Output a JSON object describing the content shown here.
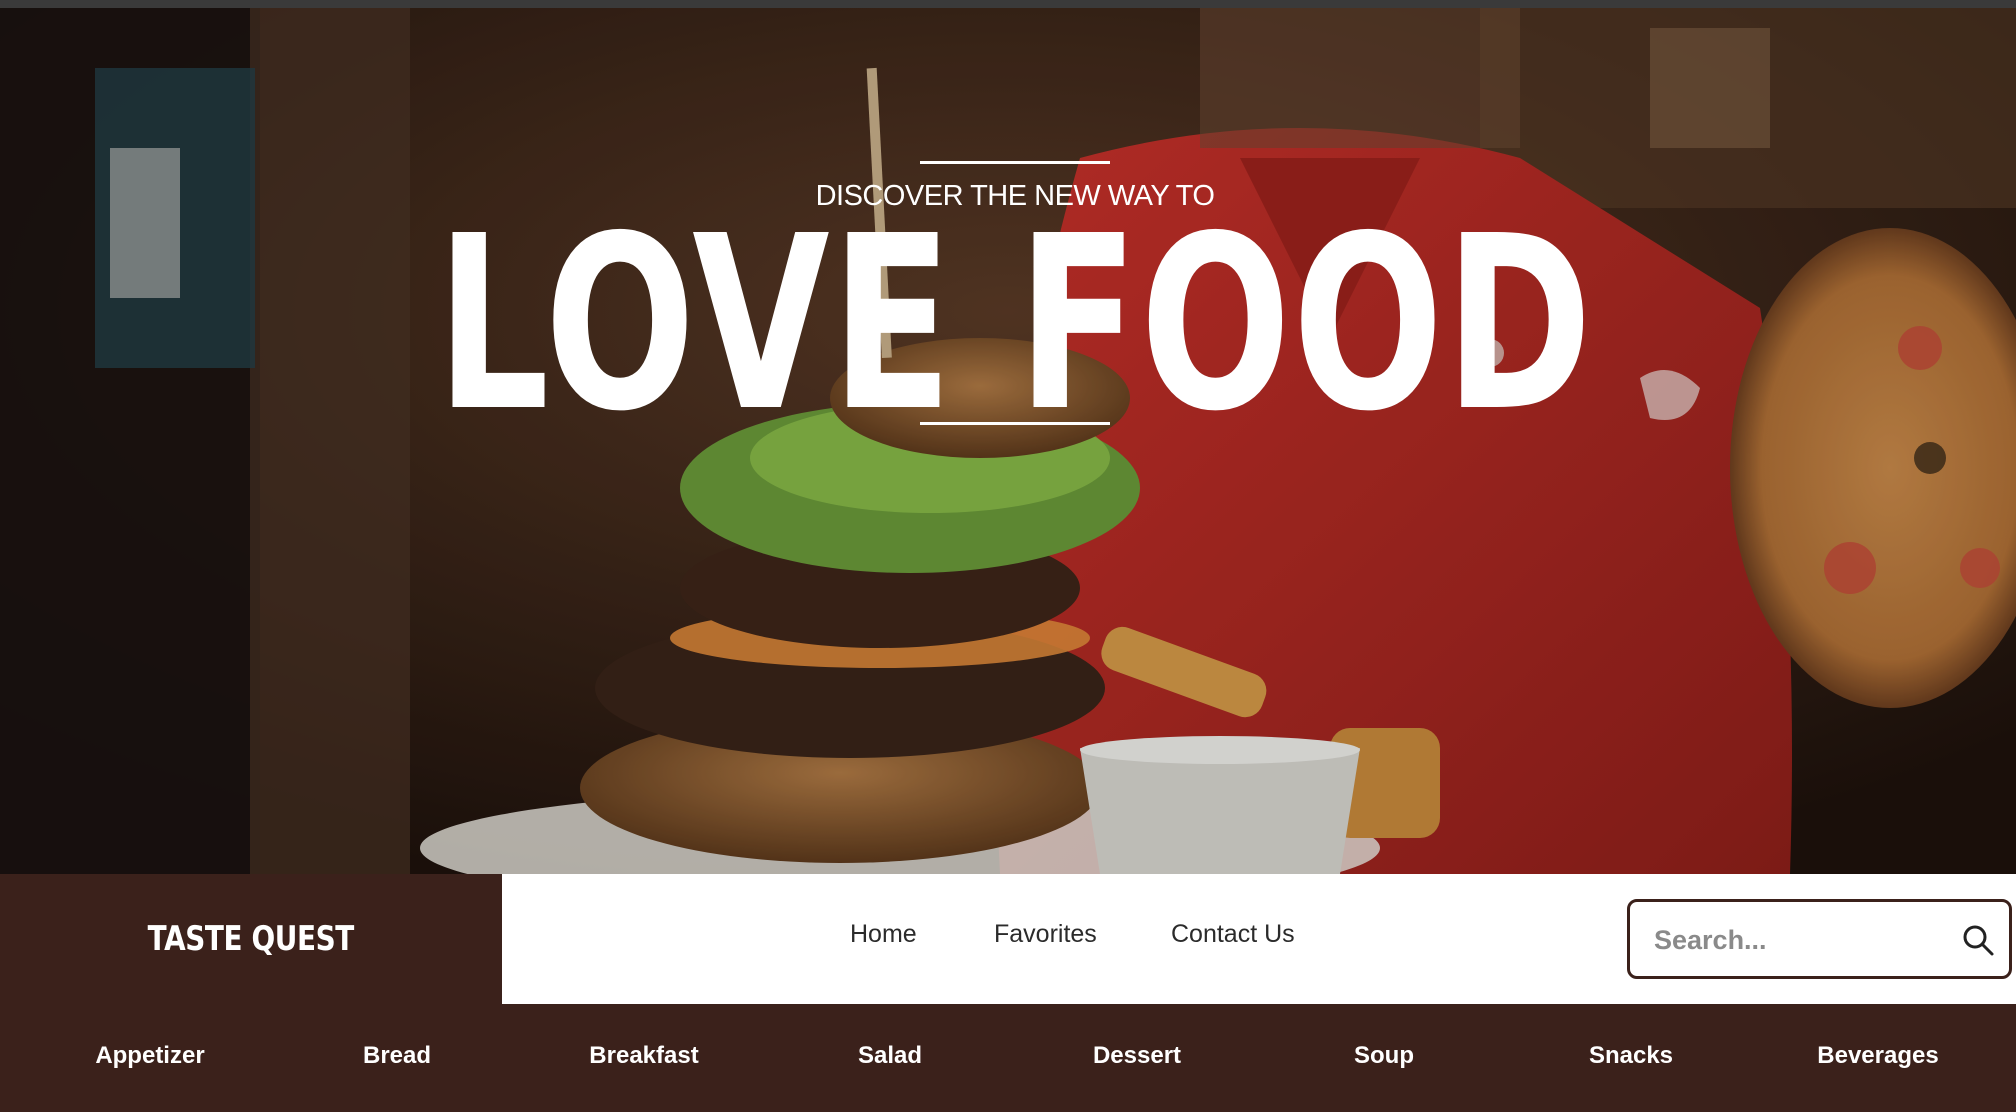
{
  "hero": {
    "subtitle": "DISCOVER THE NEW WAY TO",
    "title": "LOVE FOOD"
  },
  "navbar": {
    "brand": "TASTE QUEST",
    "links": [
      {
        "label": "Home"
      },
      {
        "label": "Favorites"
      },
      {
        "label": "Contact Us"
      }
    ],
    "search": {
      "placeholder": "Search...",
      "icon": "search-icon"
    }
  },
  "categories": [
    {
      "label": "Appetizer"
    },
    {
      "label": "Bread"
    },
    {
      "label": "Breakfast"
    },
    {
      "label": "Salad"
    },
    {
      "label": "Dessert"
    },
    {
      "label": "Soup"
    },
    {
      "label": "Snacks"
    },
    {
      "label": "Beverages"
    }
  ],
  "colors": {
    "brand_brown": "#3b211b",
    "nav_background": "#ffffff",
    "hero_text": "#ffffff"
  }
}
